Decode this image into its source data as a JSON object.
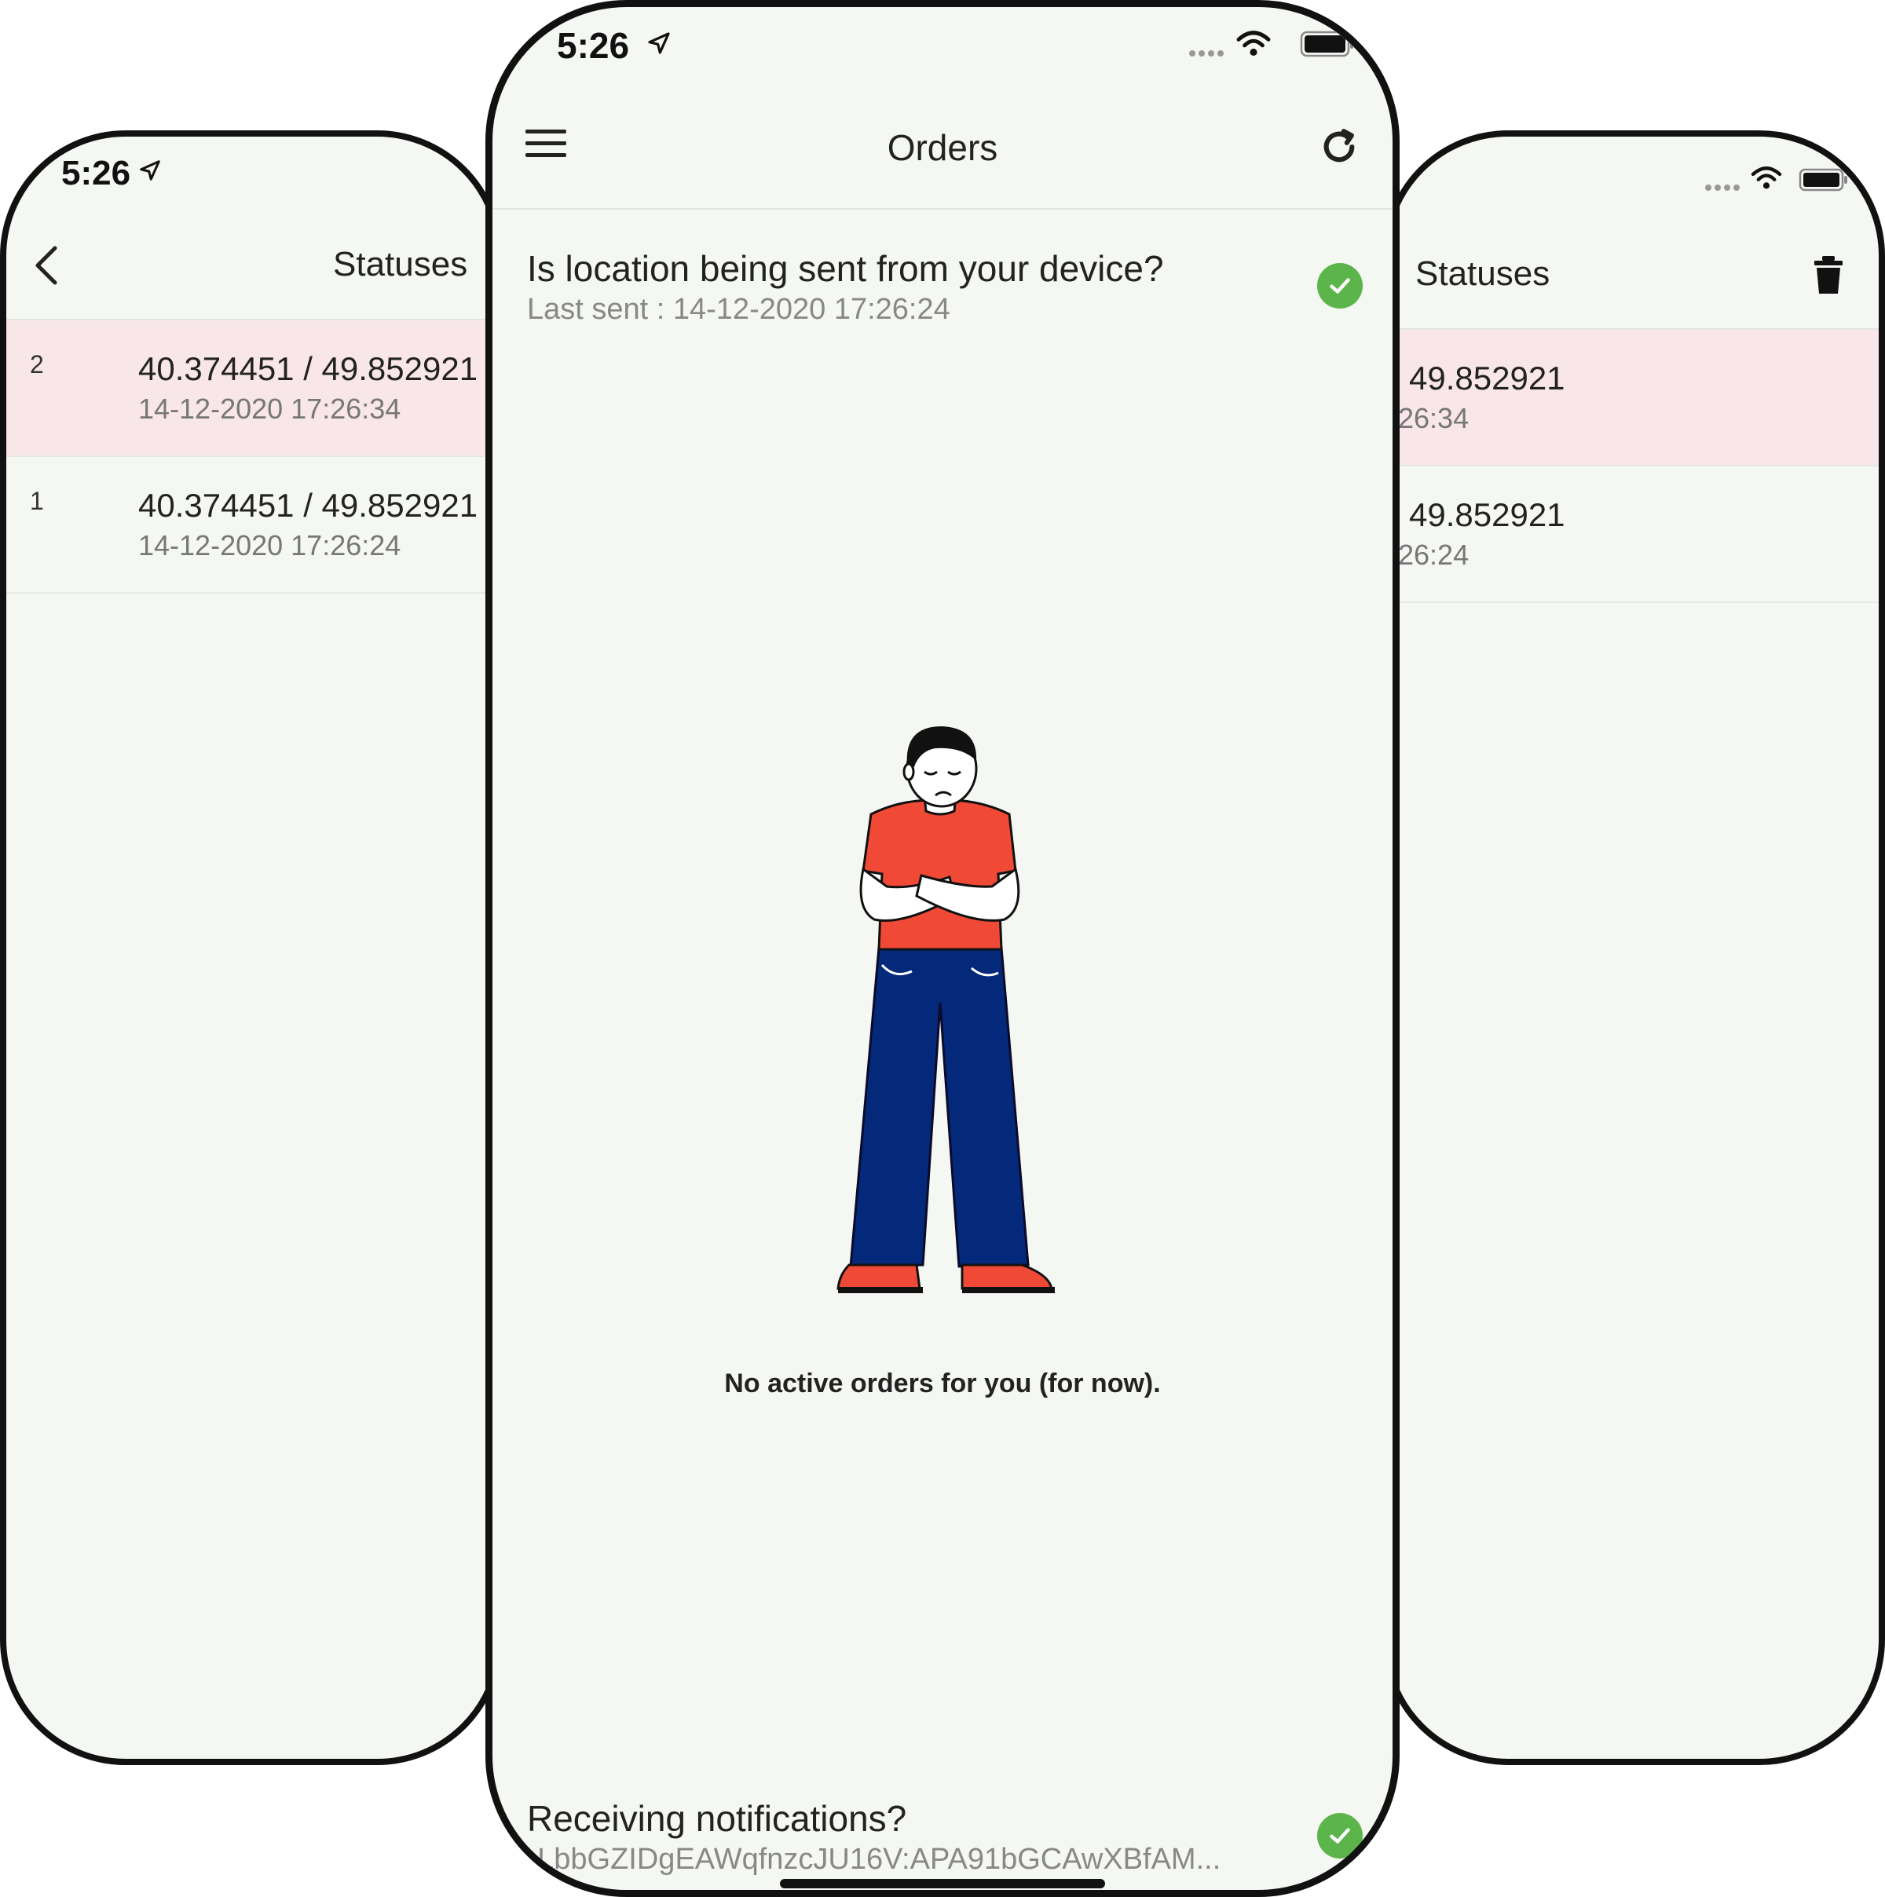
{
  "status_bar": {
    "time": "5:26"
  },
  "left_screen": {
    "title": "Statuses",
    "rows": [
      {
        "index": "2",
        "coords": "40.374451 / 49.852921",
        "timestamp": "14-12-2020 17:26:34",
        "highlighted": true
      },
      {
        "index": "1",
        "coords": "40.374451 / 49.852921",
        "timestamp": "14-12-2020 17:26:24",
        "highlighted": false
      }
    ]
  },
  "center_screen": {
    "title": "Orders",
    "location": {
      "question": "Is location being sent from your device?",
      "last_sent": "Last sent : 14-12-2020 17:26:24"
    },
    "empty_message": "No active orders for you (for now).",
    "notifications": {
      "question": "Receiving notifications?",
      "token": "eLbbGZIDgEAWqfnzcJU16V:APA91bGCAwXBfAM..."
    }
  },
  "right_screen": {
    "title": "Statuses",
    "rows": [
      {
        "coords": "49.852921",
        "timestamp": ":26:34",
        "highlighted": true
      },
      {
        "coords": "49.852921",
        "timestamp": ":26:24",
        "highlighted": false
      }
    ]
  },
  "colors": {
    "background": "#f5f7f3",
    "highlight_row": "#f8e6e9",
    "check_green": "#5cb54a",
    "shirt": "#f04a36",
    "pants": "#05297a"
  },
  "icons": [
    "location-arrow-icon",
    "back-chevron-icon",
    "menu-icon",
    "refresh-icon",
    "check-circle-icon",
    "trash-icon",
    "wifi-icon",
    "battery-icon",
    "signal-dots-icon"
  ]
}
